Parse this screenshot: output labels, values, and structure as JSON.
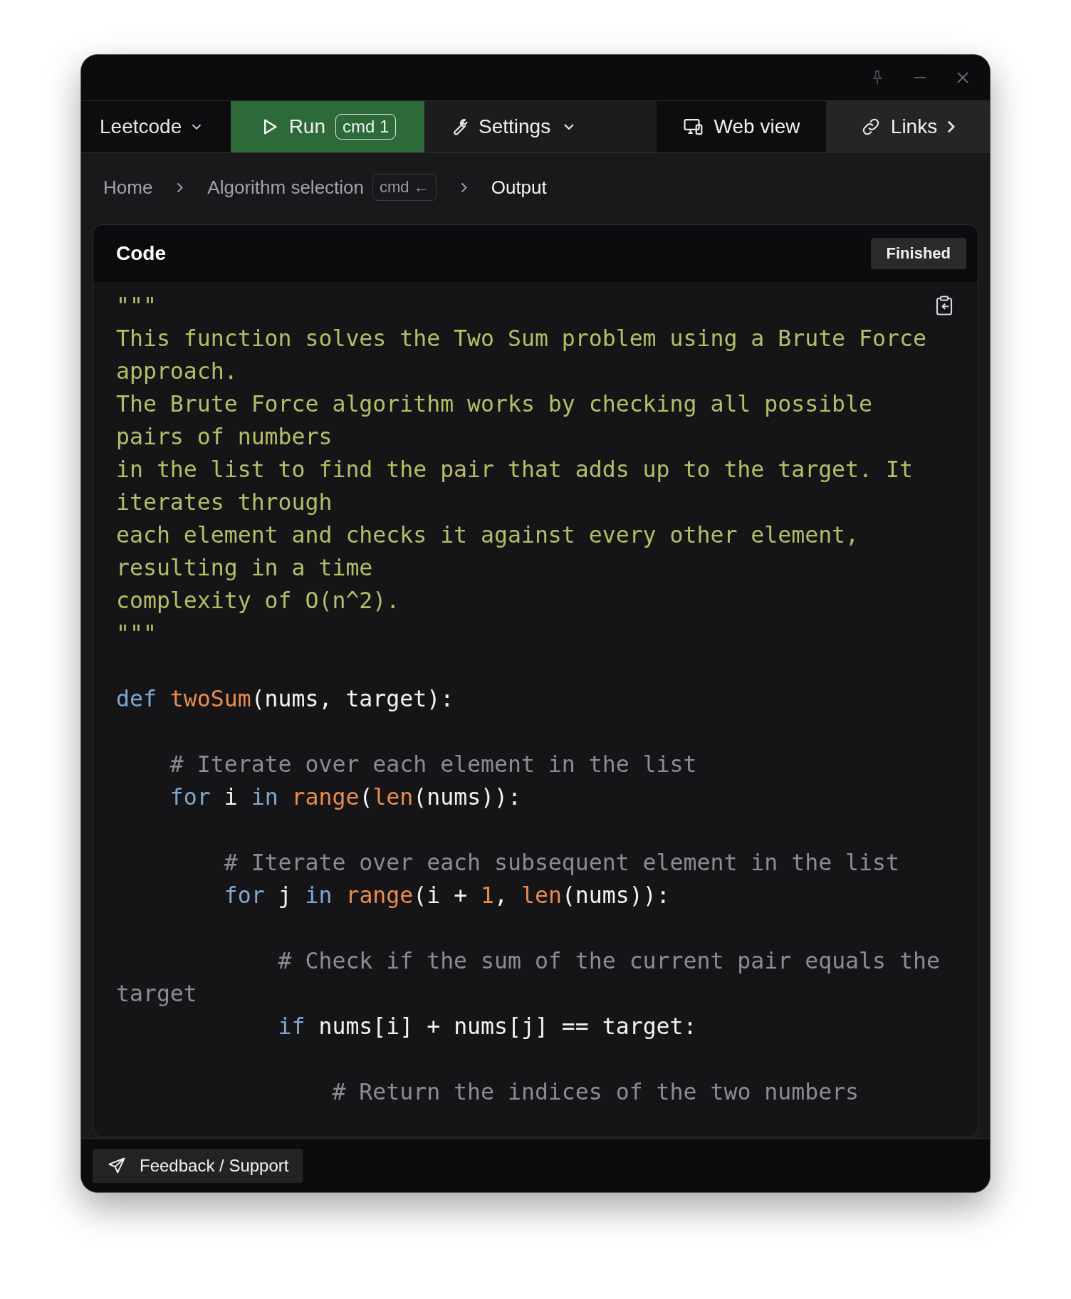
{
  "toolbar": {
    "project_menu": {
      "label": "Leetcode"
    },
    "run_button": {
      "label": "Run",
      "shortcut": "cmd 1"
    },
    "settings_menu": {
      "label": "Settings"
    },
    "web_view_button": {
      "label": "Web view"
    },
    "links_button": {
      "label": "Links"
    }
  },
  "breadcrumbs": [
    {
      "label": "Home",
      "selected": false
    },
    {
      "label": "Algorithm selection",
      "shortcut": "cmd ←",
      "selected": false
    },
    {
      "label": "Output",
      "selected": true
    }
  ],
  "code_card": {
    "title": "Code",
    "status": "Finished",
    "blocks": [
      {
        "lines": [
          {
            "tokens": [
              {
                "kind": "doc",
                "text": "\"\"\""
              }
            ]
          },
          {
            "tokens": [
              {
                "kind": "doc",
                "text": "This function solves the Two Sum problem using a Brute Force approach."
              }
            ]
          },
          {
            "tokens": [
              {
                "kind": "doc",
                "text": "The Brute Force algorithm works by checking all possible pairs of numbers"
              }
            ]
          },
          {
            "tokens": [
              {
                "kind": "doc",
                "text": "in the list to find the pair that adds up to the target. It iterates through"
              }
            ]
          },
          {
            "tokens": [
              {
                "kind": "doc",
                "text": "each element and checks it against every other element, resulting in a time"
              }
            ]
          },
          {
            "tokens": [
              {
                "kind": "doc",
                "text": "complexity of O(n^2)."
              }
            ]
          },
          {
            "tokens": [
              {
                "kind": "doc",
                "text": "\"\"\""
              }
            ]
          }
        ]
      },
      {
        "lines": [
          {
            "tokens": [
              {
                "kind": "keyword",
                "text": "def "
              },
              {
                "kind": "function",
                "text": "twoSum"
              },
              {
                "kind": "plain",
                "text": "(nums, target):"
              }
            ]
          }
        ]
      },
      {
        "lines": [
          {
            "tokens": [
              {
                "kind": "comment",
                "text": "    # Iterate over each element in the list"
              }
            ]
          },
          {
            "tokens": [
              {
                "kind": "keyword",
                "text": "    for"
              },
              {
                "kind": "plain",
                "text": " i "
              },
              {
                "kind": "keyword",
                "text": "in "
              },
              {
                "kind": "function",
                "text": "range"
              },
              {
                "kind": "plain",
                "text": "("
              },
              {
                "kind": "function",
                "text": "len"
              },
              {
                "kind": "plain",
                "text": "(nums)):"
              }
            ]
          }
        ]
      },
      {
        "lines": [
          {
            "tokens": [
              {
                "kind": "comment",
                "text": "        # Iterate over each subsequent element in the list"
              }
            ]
          },
          {
            "tokens": [
              {
                "kind": "keyword",
                "text": "        for"
              },
              {
                "kind": "plain",
                "text": " j "
              },
              {
                "kind": "keyword",
                "text": "in "
              },
              {
                "kind": "function",
                "text": "range"
              },
              {
                "kind": "plain",
                "text": "(i + "
              },
              {
                "kind": "number",
                "text": "1"
              },
              {
                "kind": "plain",
                "text": ", "
              },
              {
                "kind": "function",
                "text": "len"
              },
              {
                "kind": "plain",
                "text": "(nums)):"
              }
            ]
          }
        ]
      },
      {
        "lines": [
          {
            "tokens": [
              {
                "kind": "comment",
                "text": "            # Check if the sum of the current pair equals the target"
              }
            ]
          },
          {
            "tokens": [
              {
                "kind": "keyword",
                "text": "            if"
              },
              {
                "kind": "plain",
                "text": " nums[i] + nums[j] == target:"
              }
            ]
          }
        ]
      },
      {
        "lines": [
          {
            "tokens": [
              {
                "kind": "comment",
                "text": "                # Return the indices of the two numbers"
              }
            ]
          }
        ]
      }
    ]
  },
  "footer": {
    "feedback_button": {
      "label": "Feedback / Support"
    }
  }
}
